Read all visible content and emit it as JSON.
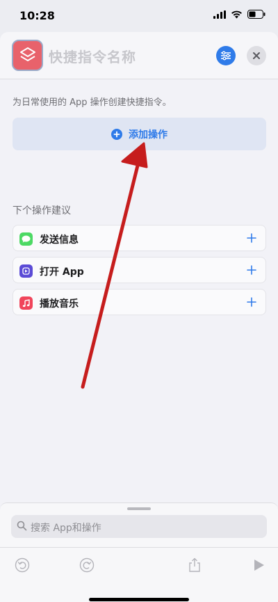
{
  "status": {
    "time": "10:28"
  },
  "header": {
    "title_placeholder": "快捷指令名称",
    "settings_icon": "sliders-icon",
    "close_icon": "close-icon"
  },
  "main": {
    "description": "为日常使用的 App 操作创建快捷指令。",
    "add_action_label": "添加操作",
    "section_title": "下个操作建议",
    "suggestions": [
      {
        "label": "发送信息",
        "icon": "message-icon",
        "color": "#4cd964"
      },
      {
        "label": "打开 App",
        "icon": "open-app-icon",
        "color": "#5b4bd6"
      },
      {
        "label": "播放音乐",
        "icon": "music-icon",
        "color": "#f0455b"
      }
    ]
  },
  "bottom": {
    "search_placeholder": "搜索 App和操作"
  },
  "colors": {
    "accent": "#2f7be9",
    "annotation_arrow": "#c61d1d"
  }
}
